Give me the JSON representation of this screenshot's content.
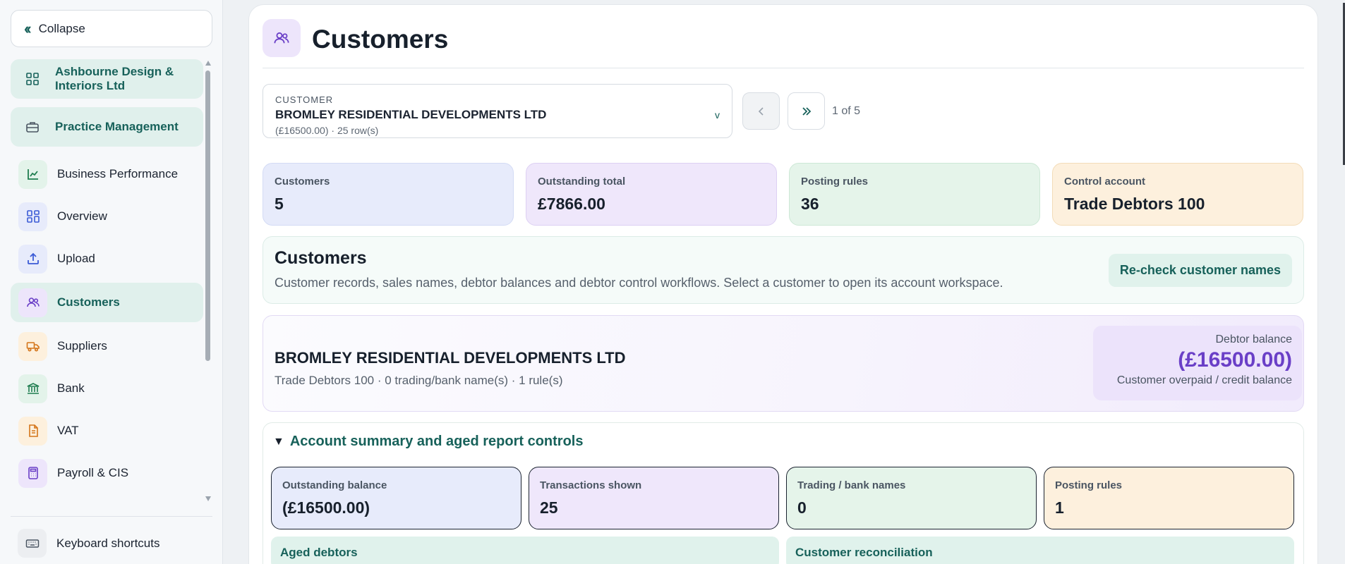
{
  "sidebar": {
    "collapse_label": "Collapse",
    "items": [
      {
        "label": "Ashbourne Design & Interiors Ltd",
        "icon": "grid-icon"
      },
      {
        "label": "Practice Management",
        "icon": "briefcase-icon"
      },
      {
        "label": "Business Performance",
        "icon": "trend-chart-icon"
      },
      {
        "label": "Overview",
        "icon": "dashboard-icon"
      },
      {
        "label": "Upload",
        "icon": "upload-icon"
      },
      {
        "label": "Customers",
        "icon": "users-icon"
      },
      {
        "label": "Suppliers",
        "icon": "truck-icon"
      },
      {
        "label": "Bank",
        "icon": "bank-icon"
      },
      {
        "label": "VAT",
        "icon": "document-icon"
      },
      {
        "label": "Payroll & CIS",
        "icon": "calculator-icon"
      }
    ],
    "keyboard_shortcuts_label": "Keyboard shortcuts"
  },
  "header": {
    "title": "Customers"
  },
  "customer_select": {
    "caption": "CUSTOMER",
    "name": "BROMLEY RESIDENTIAL DEVELOPMENTS LTD",
    "detail": "(£16500.00) · 25 row(s)",
    "caret": "v"
  },
  "pager": {
    "position": "1 of 5"
  },
  "stats": [
    {
      "label": "Customers",
      "value": "5"
    },
    {
      "label": "Outstanding total",
      "value": "£7866.00"
    },
    {
      "label": "Posting rules",
      "value": "36"
    },
    {
      "label": "Control account",
      "value": "Trade Debtors 100"
    }
  ],
  "info": {
    "heading": "Customers",
    "description": "Customer records, sales names, debtor balances and debtor control workflows. Select a customer to open its account workspace.",
    "recheck_label": "Re-check customer names"
  },
  "account": {
    "name": "BROMLEY RESIDENTIAL DEVELOPMENTS LTD",
    "meta": "Trade Debtors 100 · 0 trading/bank name(s) · 1 rule(s)",
    "balance_label": "Debtor balance",
    "balance_value": "(£16500.00)",
    "balance_caption": "Customer overpaid / credit balance"
  },
  "summary": {
    "heading": "Account summary and aged report controls",
    "stats": [
      {
        "label": "Outstanding balance",
        "value": "(£16500.00)"
      },
      {
        "label": "Transactions shown",
        "value": "25"
      },
      {
        "label": "Trading / bank names",
        "value": "0"
      },
      {
        "label": "Posting rules",
        "value": "1"
      }
    ],
    "tabs": [
      "Aged debtors",
      "Customer reconciliation"
    ]
  },
  "colors": {
    "accent": "#17615a",
    "balance_purple": "#6a3fc7",
    "active_nav_bg": "#e0f0ec"
  }
}
